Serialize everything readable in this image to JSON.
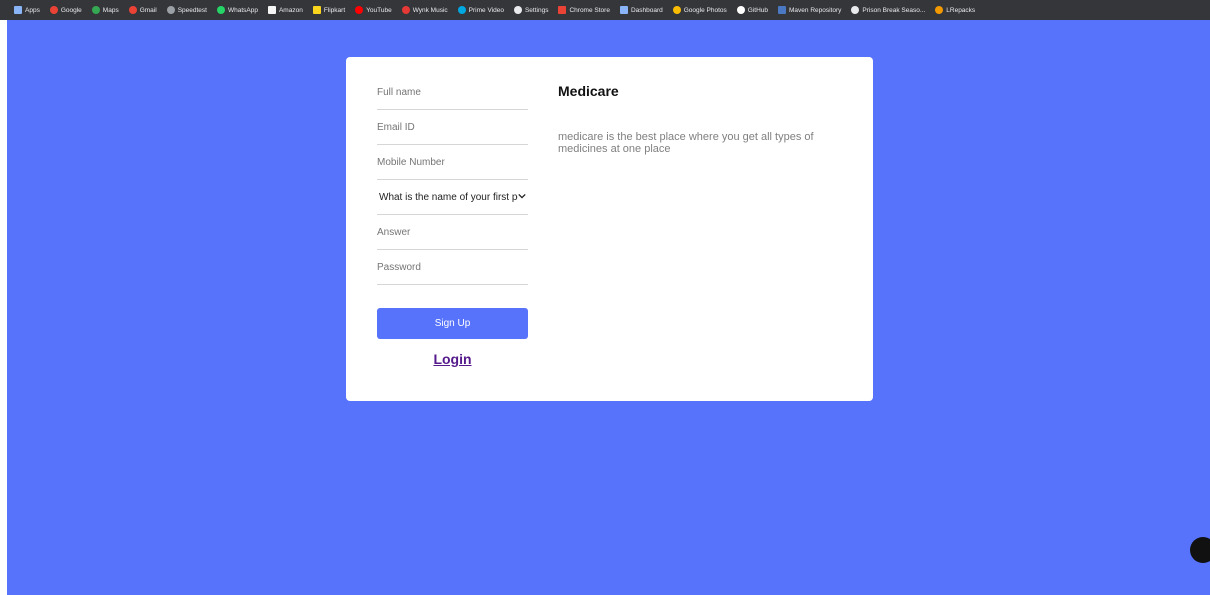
{
  "bookmarks": [
    {
      "label": "Apps",
      "icon": "apps-grid-icon",
      "color": "#8ab4f8"
    },
    {
      "label": "Google",
      "icon": "google-icon",
      "color": "#ea4335"
    },
    {
      "label": "Maps",
      "icon": "maps-pin-icon",
      "color": "#34a853"
    },
    {
      "label": "Gmail",
      "icon": "gmail-icon",
      "color": "#ea4335"
    },
    {
      "label": "Speedtest",
      "icon": "speedtest-icon",
      "color": "#9aa0a6"
    },
    {
      "label": "WhatsApp",
      "icon": "whatsapp-icon",
      "color": "#25d366"
    },
    {
      "label": "Amazon",
      "icon": "amazon-icon",
      "color": "#f5f5f5"
    },
    {
      "label": "Flipkart",
      "icon": "flipkart-icon",
      "color": "#f9d51d"
    },
    {
      "label": "YouTube",
      "icon": "youtube-icon",
      "color": "#ff0000"
    },
    {
      "label": "Wynk Music",
      "icon": "wynk-icon",
      "color": "#e53935"
    },
    {
      "label": "Prime Video",
      "icon": "prime-video-icon",
      "color": "#00a8e1"
    },
    {
      "label": "Settings",
      "icon": "gear-icon",
      "color": "#e8eaed"
    },
    {
      "label": "Chrome Store",
      "icon": "chrome-store-icon",
      "color": "#ea4335"
    },
    {
      "label": "Dashboard",
      "icon": "dashboard-icon",
      "color": "#8ab4f8"
    },
    {
      "label": "Google Photos",
      "icon": "google-photos-icon",
      "color": "#fbbc04"
    },
    {
      "label": "GitHub",
      "icon": "github-icon",
      "color": "#ffffff"
    },
    {
      "label": "Maven Repository",
      "icon": "maven-icon",
      "color": "#4a78c2"
    },
    {
      "label": "Prison Break Seaso...",
      "icon": "wordpress-icon",
      "color": "#e8eaed"
    },
    {
      "label": "LRepacks",
      "icon": "lrepacks-icon",
      "color": "#f29900"
    }
  ],
  "form": {
    "full_name_placeholder": "Full name",
    "email_placeholder": "Email ID",
    "mobile_placeholder": "Mobile Number",
    "security_question_selected": "What is the name of your first pet?",
    "answer_placeholder": "Answer",
    "password_placeholder": "Password",
    "signup_label": "Sign Up",
    "login_label": "Login"
  },
  "brand": {
    "title": "Medicare",
    "description": "medicare is the best place where you get all types of medicines at one place"
  },
  "colors": {
    "page_background": "#5773fb",
    "button_background": "#5773fb",
    "login_link": "#551a8b"
  }
}
